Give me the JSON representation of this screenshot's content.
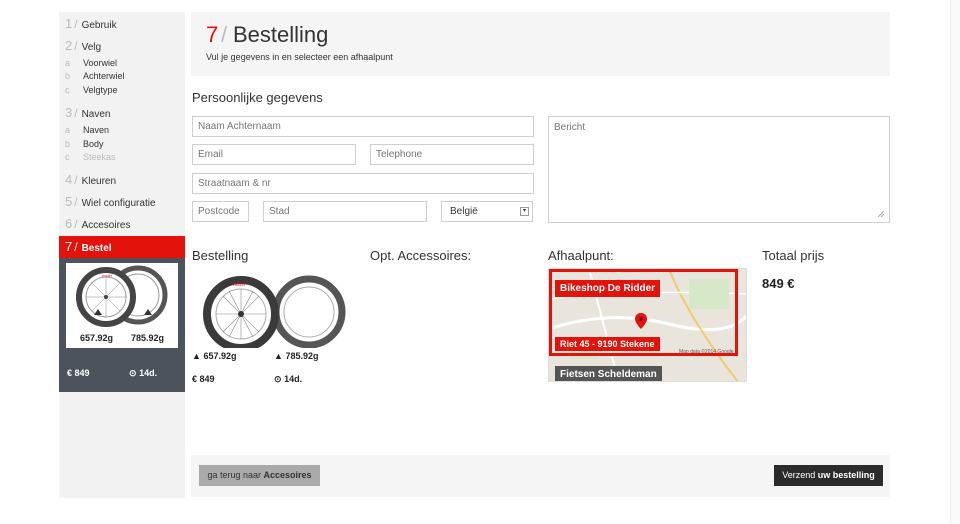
{
  "sidebar": {
    "steps": [
      {
        "num": "1",
        "label": "Gebruik"
      },
      {
        "num": "2",
        "label": "Velg"
      },
      {
        "num": "3",
        "label": "Naven"
      },
      {
        "num": "4",
        "label": "Kleuren"
      },
      {
        "num": "5",
        "label": "Wiel configuratie"
      },
      {
        "num": "6",
        "label": "Accesoires"
      },
      {
        "num": "7",
        "label": "Bestel"
      }
    ],
    "velg_subs": [
      {
        "letter": "a",
        "label": "Voorwiel"
      },
      {
        "letter": "b",
        "label": "Achterwiel"
      },
      {
        "letter": "c",
        "label": "Velgtype"
      }
    ],
    "naven_subs": [
      {
        "letter": "a",
        "label": "Naven"
      },
      {
        "letter": "b",
        "label": "Body"
      },
      {
        "letter": "c",
        "label": "Steekas"
      }
    ],
    "slash": "/",
    "summary": {
      "weight_front": "657.92g",
      "weight_rear": "785.92g",
      "price": "849",
      "days": "14d.",
      "currency_symbol": "€"
    }
  },
  "header": {
    "step_no": "7",
    "slash": "/",
    "title": "Bestelling",
    "subtitle": "Vul je gegevens in en selecteer een afhaalpunt"
  },
  "form": {
    "section_title": "Persoonlijke gegevens",
    "name_placeholder": "Naam Achternaam",
    "email_placeholder": "Email",
    "phone_placeholder": "Telephone",
    "street_placeholder": "Straatnaam & nr",
    "postcode_placeholder": "Postcode",
    "city_placeholder": "Stad",
    "country_value": "België",
    "message_placeholder": "Bericht"
  },
  "order": {
    "bestelling_title": "Bestelling",
    "accessories_title": "Opt. Accessoires:",
    "pickup_title": "Afhaalpunt:",
    "total_title": "Totaal prijs",
    "total_value": "849 €",
    "weight_front": "657.92g",
    "weight_rear": "785.92g",
    "price": "849",
    "days": "14d.",
    "currency_symbol": "€"
  },
  "map": {
    "shop_name": "Bikeshop De Ridder",
    "shop_address": "Riet 45 - 9190 Stekene",
    "next_shop": "Fietsen Scheldeman",
    "credit": "Map data ©2014 Google"
  },
  "footer": {
    "back_prefix": "ga terug naar",
    "back_target": "Accesoires",
    "send_prefix": "Verzend",
    "send_bold": "uw bestelling"
  },
  "colors": {
    "accent": "#e3120b",
    "dark_panel": "#4c535c",
    "button_dark": "#2b2b2b"
  }
}
